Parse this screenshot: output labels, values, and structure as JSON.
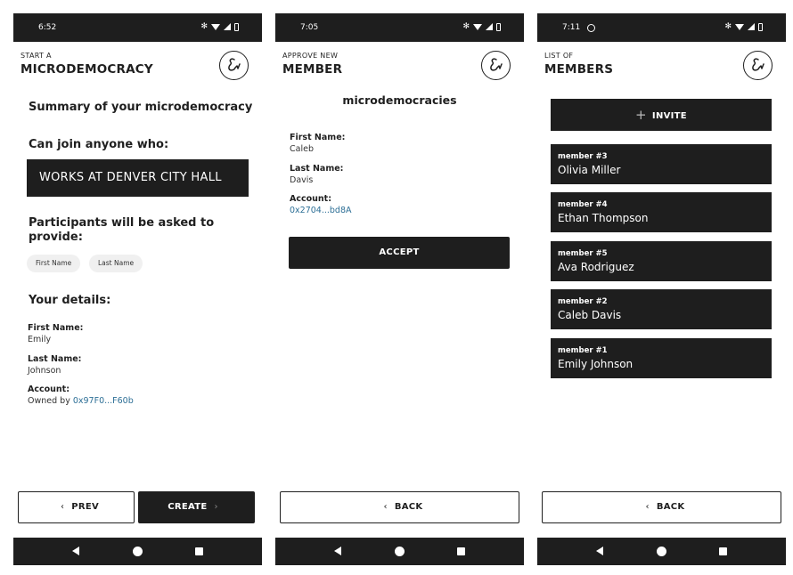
{
  "screens": [
    {
      "status_time": "6:52",
      "header_eyebrow": "START A",
      "header_title": "MICRODEMOCRACY",
      "summary_heading": "Summary of your microdemocracy",
      "can_join_heading": "Can join anyone who:",
      "criteria": "WORKS AT DENVER CITY HALL",
      "participants_heading": "Participants will be asked to provide:",
      "chips": [
        "First Name",
        "Last Name"
      ],
      "your_details_heading": "Your details:",
      "first_name_label": "First Name:",
      "first_name_value": "Emily",
      "last_name_label": "Last Name:",
      "last_name_value": "Johnson",
      "account_label": "Account:",
      "account_prefix": "Owned by ",
      "account_value": "0x97F0...F60b",
      "prev_label": "PREV",
      "create_label": "CREATE"
    },
    {
      "status_time": "7:05",
      "header_eyebrow": "APPROVE NEW",
      "header_title": "MEMBER",
      "title": "microdemocracies",
      "first_name_label": "First Name:",
      "first_name_value": "Caleb",
      "last_name_label": "Last Name:",
      "last_name_value": "Davis",
      "account_label": "Account:",
      "account_value": "0x2704...bd8A",
      "accept_label": "ACCEPT",
      "back_label": "BACK"
    },
    {
      "status_time": "7:11",
      "header_eyebrow": "LIST OF",
      "header_title": "MEMBERS",
      "invite_label": "INVITE",
      "members": [
        {
          "label": "member #3",
          "name": "Olivia Miller"
        },
        {
          "label": "member #4",
          "name": "Ethan Thompson"
        },
        {
          "label": "member #5",
          "name": "Ava Rodriguez"
        },
        {
          "label": "member #2",
          "name": "Caleb Davis"
        },
        {
          "label": "member #1",
          "name": "Emily Johnson"
        }
      ],
      "back_label": "BACK"
    }
  ],
  "icons": {
    "status": [
      "bluetooth-icon",
      "wifi-icon",
      "signal-icon",
      "battery-icon"
    ],
    "nav": [
      "nav-back-icon",
      "nav-home-icon",
      "nav-recent-icon"
    ],
    "logo": "ampersand-logo-icon",
    "extra_status_p3": "whatsapp-icon"
  },
  "colors": {
    "dark": "#1e1e1e",
    "link": "#2d6f96",
    "chip_bg": "#f0f0f0"
  }
}
